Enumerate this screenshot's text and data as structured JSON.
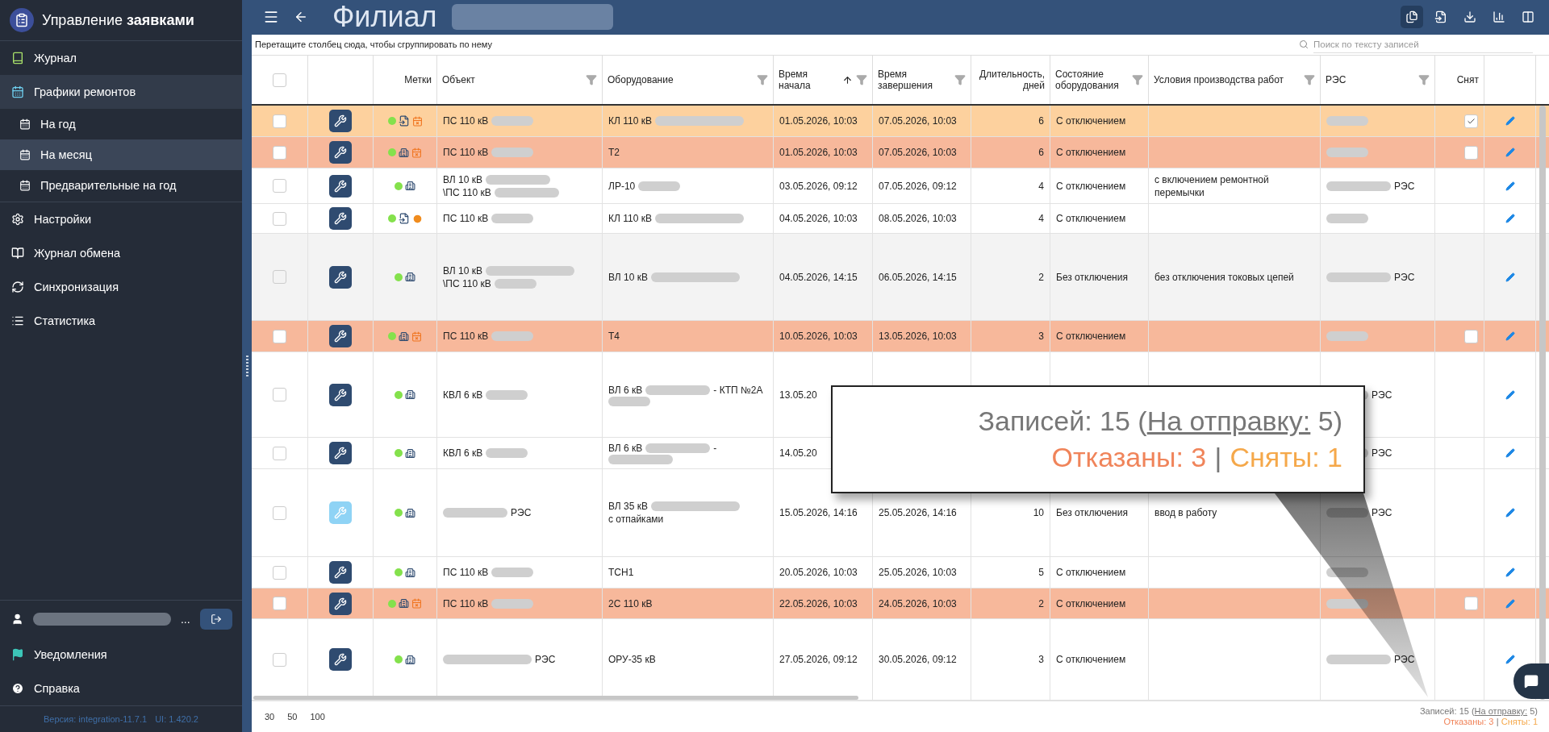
{
  "sidebar": {
    "brand": "Управление **заявками**",
    "items": [
      {
        "label": "Журнал",
        "selected": false
      },
      {
        "label": "Графики ремонтов",
        "selected": true,
        "expanded": true,
        "children": [
          {
            "label": "На год",
            "selected": false
          },
          {
            "label": "На месяц",
            "selected": true
          },
          {
            "label": "Предварительные на год",
            "selected": false
          }
        ]
      },
      {
        "label": "Настройки",
        "selected": false
      },
      {
        "label": "Журнал обмена",
        "selected": false
      },
      {
        "label": "Синхронизация",
        "selected": false
      },
      {
        "label": "Статистика",
        "selected": false
      }
    ],
    "user": {
      "name_tail": "..."
    },
    "bottom_items": [
      {
        "label": "Уведомления"
      },
      {
        "label": "Справка"
      }
    ],
    "version": "Версия: integration-11.7.1",
    "ui_version": "UI: 1.420.2"
  },
  "header": {
    "title": "Филиал",
    "tools": [
      {
        "selected": true
      },
      {
        "selected": false
      },
      {
        "selected": false
      },
      {
        "selected": false
      },
      {
        "selected": false
      }
    ]
  },
  "group_panel": {
    "hint": "Перетащите столбец сюда, чтобы сгруппировать по нему"
  },
  "search": {
    "placeholder": "Поиск по тексту записей"
  },
  "table": {
    "select_all": {
      "checked": false
    },
    "columns": [
      {
        "kind": "select"
      },
      {
        "kind": "tool"
      },
      {
        "kind": "marks",
        "label": "Метки"
      },
      {
        "kind": "text",
        "label": "Объект",
        "filter": true
      },
      {
        "kind": "text",
        "label": "Оборудование",
        "filter": true
      },
      {
        "kind": "text",
        "label": "Время начала",
        "filter": true,
        "sorted": true
      },
      {
        "kind": "text",
        "label": "Время завершения",
        "filter": true
      },
      {
        "kind": "number",
        "label": "Длительность, дней"
      },
      {
        "kind": "text",
        "label": "Состояние оборудования",
        "filter": true
      },
      {
        "kind": "text",
        "label": "Условия производства работ",
        "filter": true
      },
      {
        "kind": "text",
        "label": "РЭС",
        "filter": true
      },
      {
        "kind": "check",
        "label": "Снят"
      },
      {
        "kind": "edit"
      }
    ],
    "rows": [
      {
        "removed": true,
        "refused": false,
        "hovered": false,
        "checked": false,
        "muted": false,
        "marks": [
          {
            "kind": "dot"
          },
          {
            "kind": "doc"
          },
          {
            "kind": "calendar"
          }
        ],
        "object": [
          "ПС 110 кВ",
          {
            "kind": "blur_short"
          }
        ],
        "equipment": [
          "КЛ 110 кВ",
          {
            "kind": "blur_long"
          }
        ],
        "start": "01.05.2026, 10:03",
        "end": "07.05.2026, 10:03",
        "days": "6",
        "state": "С отключением",
        "res": [
          {
            "kind": "blur_short"
          }
        ],
        "taken_off": {
          "checked": true
        }
      },
      {
        "removed": false,
        "refused": true,
        "hovered": false,
        "checked": false,
        "muted": false,
        "marks": [
          {
            "kind": "dot"
          },
          {
            "kind": "building"
          },
          {
            "kind": "calendar"
          }
        ],
        "object": [
          "ПС 110 кВ",
          {
            "kind": "blur_short"
          }
        ],
        "equipment": [
          "Т2"
        ],
        "start": "01.05.2026, 10:03",
        "end": "07.05.2026, 10:03",
        "days": "6",
        "state": "С отключением",
        "res": [
          {
            "kind": "blur_short"
          }
        ],
        "taken_off": {
          "checked": false
        }
      },
      {
        "removed": false,
        "refused": false,
        "hovered": false,
        "checked": false,
        "muted": false,
        "marks": [
          {
            "kind": "dot"
          },
          {
            "kind": "building"
          }
        ],
        "object": [
          "ВЛ 10 кВ",
          {
            "kind": "blur_medium"
          },
          "\\ПС 110 кВ",
          {
            "kind": "blur_medium"
          }
        ],
        "equipment": [
          "ЛР-10",
          {
            "kind": "blur_short"
          }
        ],
        "start": "03.05.2026, 09:12",
        "end": "07.05.2026, 09:12",
        "days": "4",
        "state": "С отключением",
        "conditions": "с включением ремонтной перемычки",
        "res": [
          {
            "kind": "blur_medium"
          },
          "РЭС"
        ]
      },
      {
        "removed": false,
        "refused": false,
        "hovered": false,
        "checked": false,
        "muted": false,
        "marks": [
          {
            "kind": "dot"
          },
          {
            "kind": "doc"
          },
          {
            "kind": "clock"
          }
        ],
        "object": [
          "ПС 110 кВ",
          {
            "kind": "blur_short"
          }
        ],
        "equipment": [
          "КЛ 110 кВ",
          {
            "kind": "blur_long"
          }
        ],
        "start": "04.05.2026, 10:03",
        "end": "08.05.2026, 10:03",
        "days": "4",
        "state": "С отключением",
        "res": [
          {
            "kind": "blur_short"
          }
        ]
      },
      {
        "removed": false,
        "refused": false,
        "hovered": true,
        "checked": false,
        "muted": false,
        "marks": [
          {
            "kind": "dot"
          },
          {
            "kind": "building"
          }
        ],
        "object": [
          "ВЛ 10 кВ",
          {
            "kind": "blur_long"
          },
          "\\ПС 110 кВ",
          {
            "kind": "blur_short"
          }
        ],
        "equipment": [
          "ВЛ 10 кВ",
          {
            "kind": "blur_long"
          }
        ],
        "start": "04.05.2026, 14:15",
        "end": "06.05.2026, 14:15",
        "days": "2",
        "state": "Без отключения",
        "conditions": "без отключения токовых цепей",
        "res": [
          {
            "kind": "blur_medium"
          },
          "РЭС"
        ]
      },
      {
        "removed": false,
        "refused": true,
        "hovered": false,
        "checked": false,
        "muted": false,
        "marks": [
          {
            "kind": "dot"
          },
          {
            "kind": "building"
          },
          {
            "kind": "calendar"
          }
        ],
        "object": [
          "ПС 110 кВ",
          {
            "kind": "blur_short"
          }
        ],
        "equipment": [
          "Т4"
        ],
        "start": "10.05.2026, 10:03",
        "end": "13.05.2026, 10:03",
        "days": "3",
        "state": "С отключением",
        "res": [
          {
            "kind": "blur_short"
          }
        ],
        "taken_off": {
          "checked": false
        }
      },
      {
        "removed": false,
        "refused": false,
        "hovered": false,
        "checked": false,
        "muted": false,
        "marks": [
          {
            "kind": "dot"
          },
          {
            "kind": "building"
          }
        ],
        "object": [
          "КВЛ 6 кВ",
          {
            "kind": "blur_short"
          }
        ],
        "equipment": [
          "ВЛ 6 кВ",
          {
            "kind": "blur_medium"
          },
          "- КТП №2А",
          {
            "kind": "blur_short"
          }
        ],
        "start": "13.05.20",
        "res": [
          {
            "kind": "blur_short"
          },
          "РЭС"
        ]
      },
      {
        "removed": false,
        "refused": false,
        "hovered": false,
        "checked": false,
        "muted": false,
        "marks": [
          {
            "kind": "dot"
          },
          {
            "kind": "building"
          }
        ],
        "object": [
          "КВЛ 6 кВ",
          {
            "kind": "blur_short"
          }
        ],
        "equipment": [
          "ВЛ 6 кВ",
          {
            "kind": "blur_medium"
          },
          "-",
          {
            "kind": "blur_medium"
          }
        ],
        "start": "14.05.20",
        "res": [
          {
            "kind": "blur_short"
          },
          "РЭС"
        ]
      },
      {
        "removed": false,
        "refused": false,
        "hovered": false,
        "checked": false,
        "muted": true,
        "marks": [
          {
            "kind": "dot"
          },
          {
            "kind": "building"
          }
        ],
        "object": [
          {
            "kind": "blur_medium"
          },
          "РЭС"
        ],
        "equipment": [
          "ВЛ 35 кВ",
          {
            "kind": "blur_long"
          },
          "с отпайками"
        ],
        "start": "15.05.2026, 14:16",
        "end": "25.05.2026, 14:16",
        "days": "10",
        "state": "Без отключения",
        "conditions": "ввод в работу",
        "res": [
          {
            "kind": "blur_short"
          },
          "РЭС"
        ]
      },
      {
        "removed": false,
        "refused": false,
        "hovered": false,
        "checked": false,
        "muted": false,
        "marks": [
          {
            "kind": "dot"
          },
          {
            "kind": "building"
          }
        ],
        "object": [
          "ПС 110 кВ",
          {
            "kind": "blur_short"
          }
        ],
        "equipment": [
          "ТСН1"
        ],
        "start": "20.05.2026, 10:03",
        "end": "25.05.2026, 10:03",
        "days": "5",
        "state": "С отключением",
        "res": [
          {
            "kind": "blur_short"
          }
        ]
      },
      {
        "removed": false,
        "refused": true,
        "hovered": false,
        "checked": false,
        "muted": false,
        "marks": [
          {
            "kind": "dot"
          },
          {
            "kind": "building"
          },
          {
            "kind": "calendar"
          }
        ],
        "object": [
          "ПС 110 кВ",
          {
            "kind": "blur_short"
          }
        ],
        "equipment": [
          "2С 110 кВ"
        ],
        "start": "22.05.2026, 10:03",
        "end": "24.05.2026, 10:03",
        "days": "2",
        "state": "С отключением",
        "res": [
          {
            "kind": "blur_short"
          }
        ],
        "taken_off": {
          "checked": false
        }
      },
      {
        "removed": false,
        "refused": false,
        "hovered": false,
        "checked": false,
        "muted": false,
        "marks": [
          {
            "kind": "dot"
          },
          {
            "kind": "building"
          }
        ],
        "object": [
          {
            "kind": "blur_long"
          },
          "РЭС"
        ],
        "equipment": [
          "ОРУ-35 кВ"
        ],
        "start": "27.05.2026, 09:12",
        "end": "30.05.2026, 09:12",
        "days": "3",
        "state": "С отключением",
        "res": [
          {
            "kind": "blur_medium"
          },
          "РЭС"
        ]
      }
    ]
  },
  "pager": {
    "sizes": [
      "30",
      "50",
      "100"
    ]
  },
  "summary": {
    "prefix": "Записей: 15 (",
    "link": "На отправку:",
    "suffix": " 5)",
    "refused": "Отказаны: 3",
    "separator": "|",
    "removed": "Сняты: 1"
  },
  "callout": {
    "prefix": "Записей: 15 (",
    "link": "На отправку:",
    "suffix": " 5)",
    "refused": "Отказаны: 3",
    "separator": "|",
    "removed": "Сняты: 1"
  }
}
